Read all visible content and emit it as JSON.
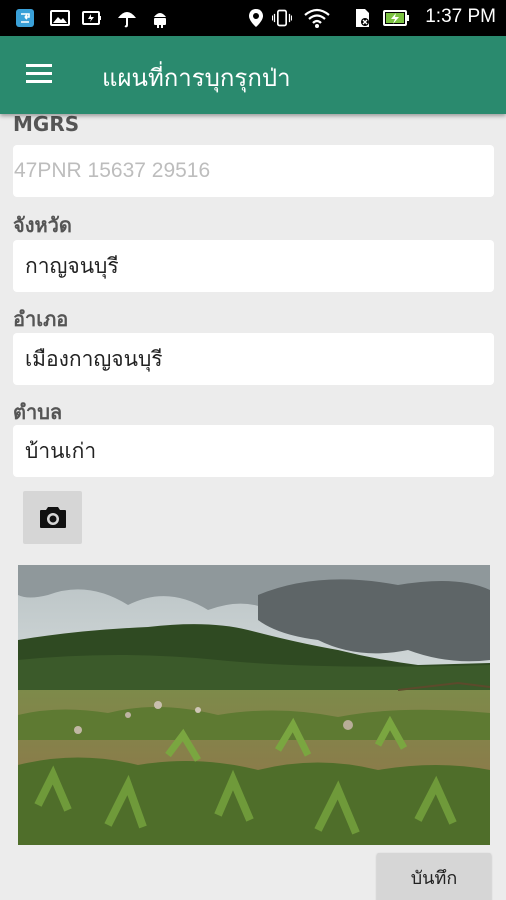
{
  "status_bar": {
    "time": "1:37 PM",
    "icons": [
      "app-notification-icon",
      "image-icon",
      "battery-saver-icon",
      "umbrella-icon",
      "android-icon",
      "location-icon",
      "vibrate-icon",
      "wifi-icon",
      "sim-icon",
      "battery-charging-icon"
    ]
  },
  "toolbar": {
    "title": "แผนที่การบุกรุกป่า",
    "menu_icon": "hamburger-menu-icon"
  },
  "form": {
    "mgrs": {
      "label": "MGRS",
      "value": "47PNR 15637 29516"
    },
    "province": {
      "label": "จังหวัด",
      "value": "กาญจนบุรี"
    },
    "district": {
      "label": "อำเภอ",
      "value": "เมืองกาญจนบุรี"
    },
    "subdistrict": {
      "label": "ตำบล",
      "value": "บ้านเก่า"
    }
  },
  "camera_button": {
    "icon": "camera-icon"
  },
  "save_button": {
    "label": "บันทึก"
  },
  "colors": {
    "toolbar": "#2a8a6e",
    "background": "#ececec",
    "button": "#d6d6d6"
  }
}
